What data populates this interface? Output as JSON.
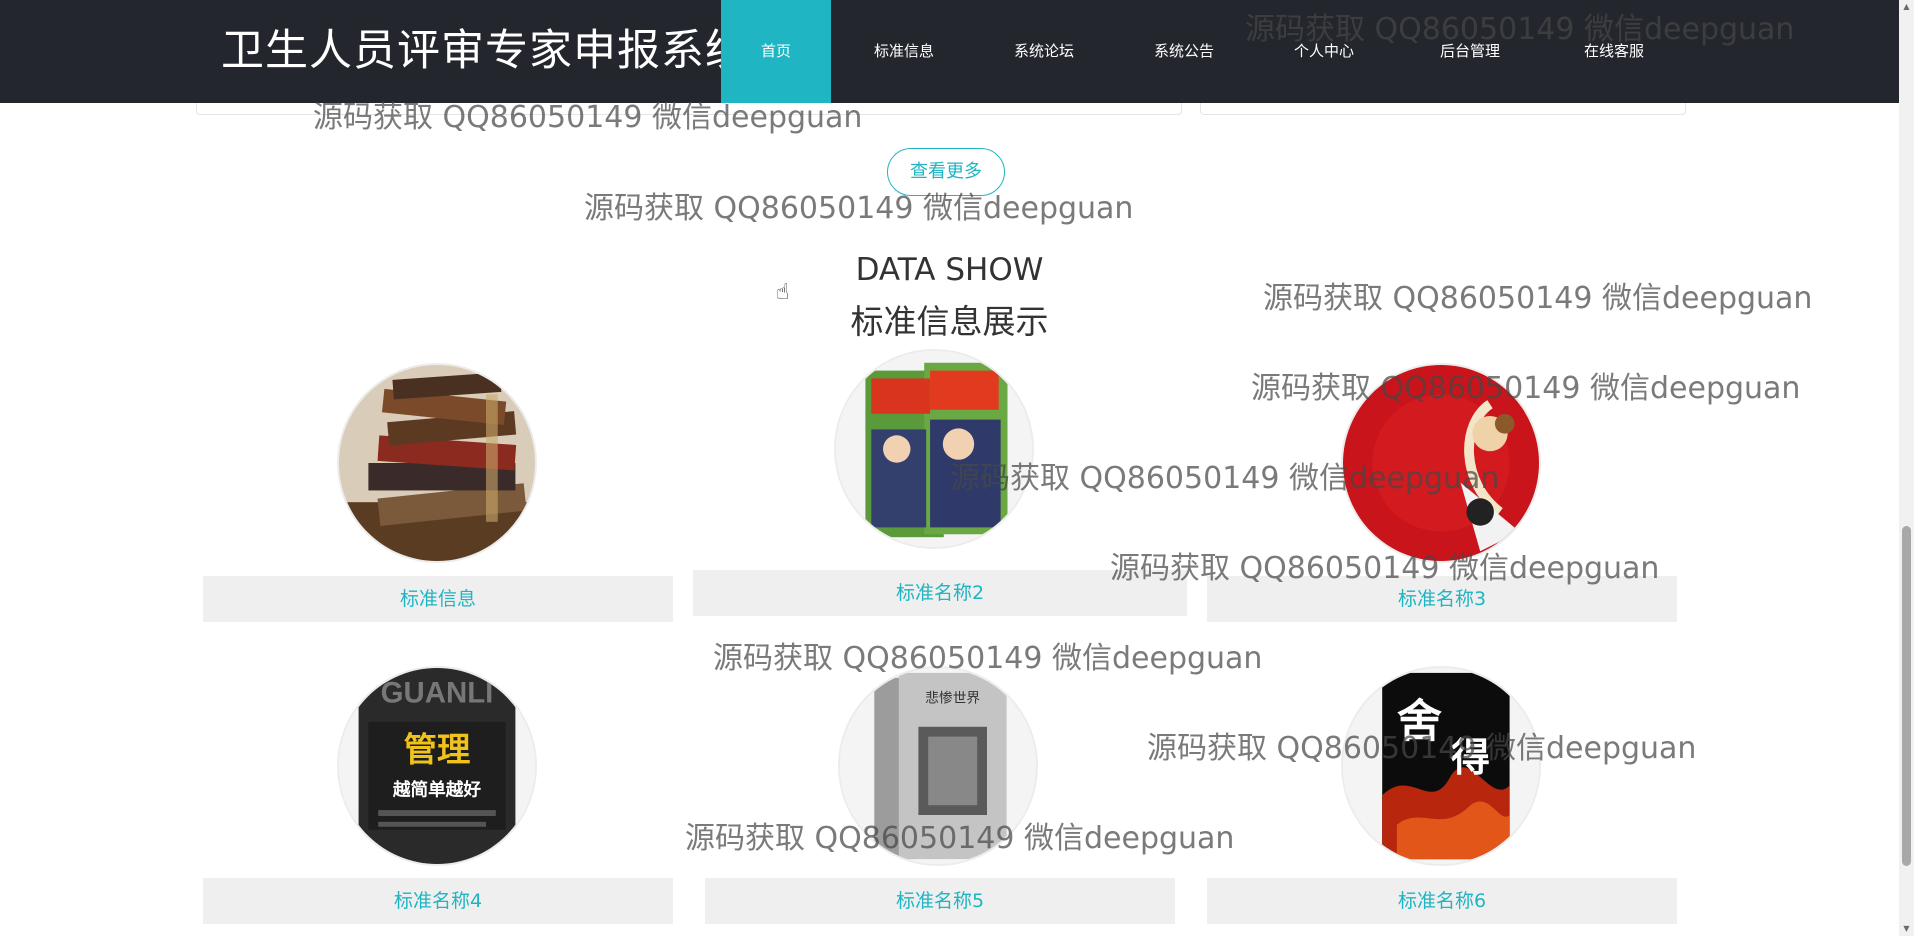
{
  "header": {
    "site_title": "卫生人员评审专家申报系统",
    "nav": [
      {
        "label": "首页",
        "active": true
      },
      {
        "label": "标准信息"
      },
      {
        "label": "系统论坛"
      },
      {
        "label": "系统公告"
      },
      {
        "label": "个人中心"
      },
      {
        "label": "后台管理"
      },
      {
        "label": "在线客服"
      }
    ]
  },
  "more_button": "查看更多",
  "section": {
    "title_en": "DATA SHOW",
    "title_cn": "标准信息展示"
  },
  "items": [
    {
      "label": "标准信息",
      "icon": "old-books-image"
    },
    {
      "label": "标准名称2",
      "icon": "conan-comic-image"
    },
    {
      "label": "标准名称3",
      "icon": "monkey-king-image"
    },
    {
      "label": "标准名称4",
      "icon": "management-book-image"
    },
    {
      "label": "标准名称5",
      "icon": "tragic-world-book-image"
    },
    {
      "label": "标准名称6",
      "icon": "shede-book-image"
    }
  ],
  "watermark": "源码获取 QQ86050149 微信deepguan",
  "colors": {
    "nav_bg": "#23262d",
    "accent": "#1fb5c3",
    "label_bg": "#efefef"
  }
}
